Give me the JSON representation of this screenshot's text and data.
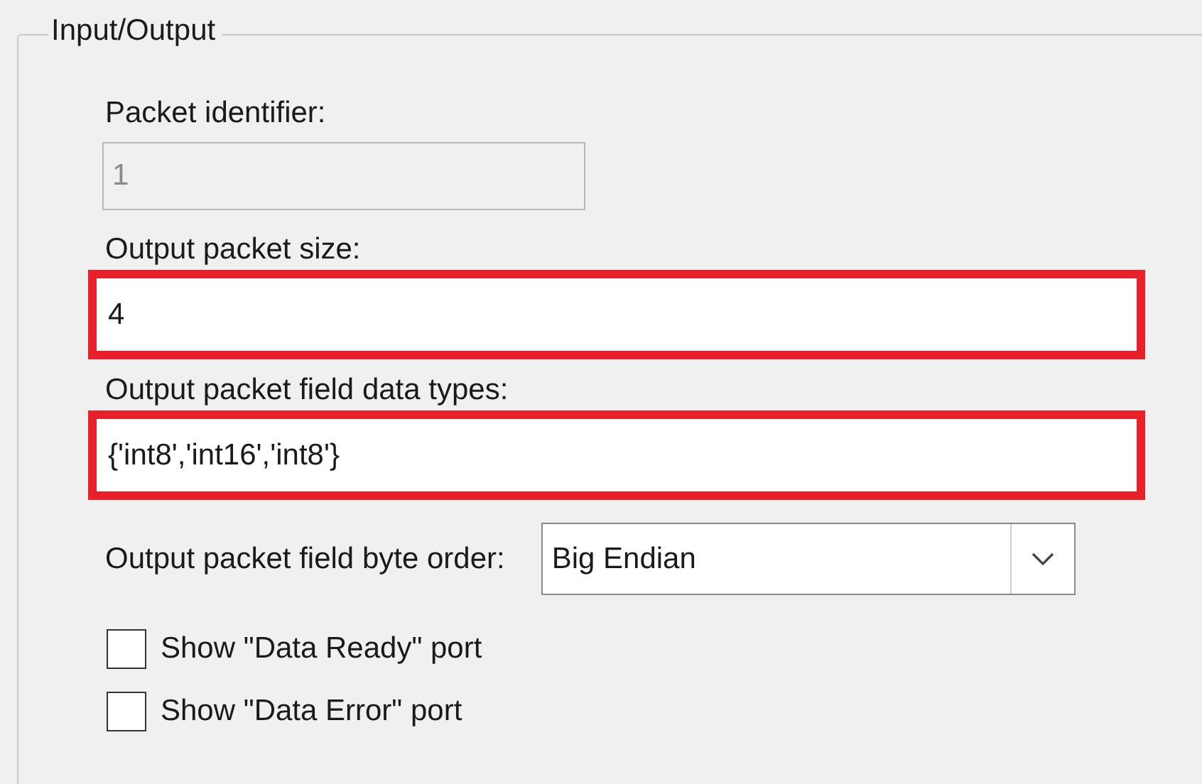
{
  "group": {
    "title": "Input/Output"
  },
  "fields": [
    {
      "label": "Packet identifier:",
      "value": "1",
      "disabled": true,
      "highlighted": false
    },
    {
      "label": "Output packet size:",
      "value": "4",
      "disabled": false,
      "highlighted": true
    },
    {
      "label": "Output packet field data types:",
      "value": "{'int8','int16','int8'}",
      "disabled": false,
      "highlighted": true
    }
  ],
  "byte_order": {
    "label": "Output packet field byte order:",
    "value": "Big Endian"
  },
  "checkboxes": [
    {
      "label": "Show \"Data Ready\" port",
      "checked": false
    },
    {
      "label": "Show \"Data Error\" port",
      "checked": false
    }
  ]
}
